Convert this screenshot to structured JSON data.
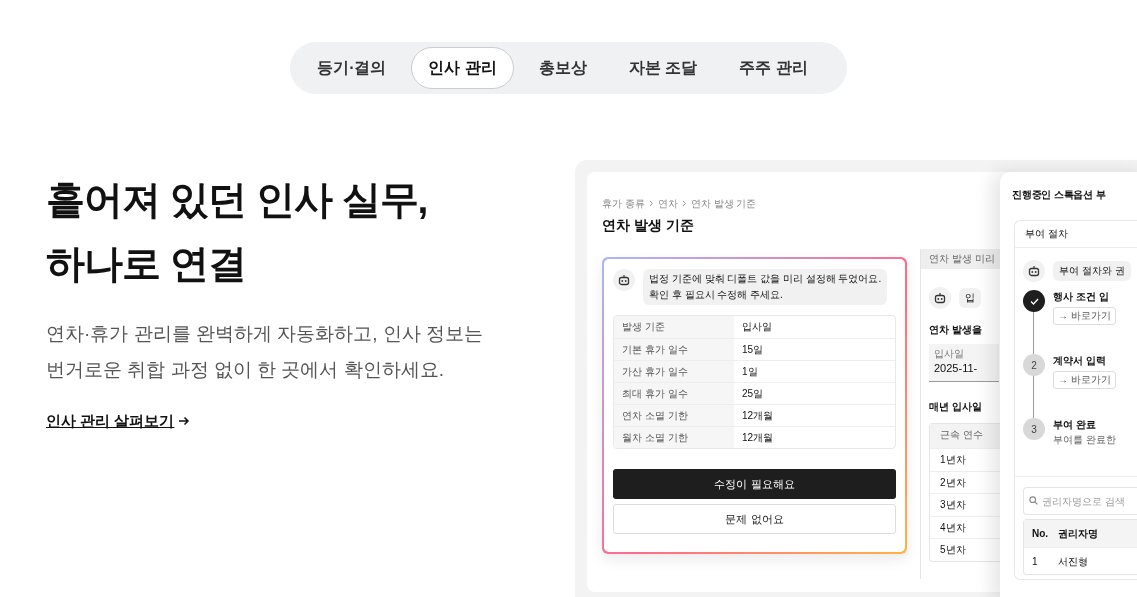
{
  "tabs": [
    {
      "label": "등기·결의",
      "selected": false
    },
    {
      "label": "인사 관리",
      "selected": true
    },
    {
      "label": "총보상",
      "selected": false
    },
    {
      "label": "자본 조달",
      "selected": false
    },
    {
      "label": "주주 관리",
      "selected": false
    }
  ],
  "hero": {
    "title_lines": [
      "흩어져 있던 인사 실무,",
      "하나로 연결"
    ],
    "description_lines": [
      "연차·휴가 관리를 완벽하게 자동화하고, 인사 정보는",
      "번거로운 취합 과정 없이 한 곳에서 확인하세요."
    ],
    "link": "인사 관리 살펴보기"
  },
  "mockup": {
    "leave_panel": {
      "breadcrumb": [
        "휴가 종류",
        "연차",
        "연차 발생 기준"
      ],
      "title": "연차 발생 기준",
      "assistant_message_lines": [
        "법정 기준에 맞춰 디폴트 값을 미리 설정해 두었어요.",
        "확인 후 필요시 수정해 주세요."
      ],
      "table": {
        "rows": [
          {
            "label": "발생 기준",
            "value": "입사일"
          },
          {
            "label": "기본 휴가 일수",
            "value": "15일"
          },
          {
            "label": "가산 휴가 일수",
            "value": "1일"
          },
          {
            "label": "최대 휴가 일수",
            "value": "25일"
          },
          {
            "label": "연차 소멸 기한",
            "value": "12개월"
          },
          {
            "label": "월차 소멸 기한",
            "value": "12개월"
          }
        ]
      },
      "buttons": [
        {
          "label": "수정이 필요해요",
          "kind": "primary"
        },
        {
          "label": "문제 없어요",
          "kind": "secondary"
        }
      ]
    },
    "preview_panel": {
      "header": "연차 발생 미리",
      "assistant_message": "입",
      "heading": "연차 발생을",
      "date_field": {
        "label": "입사일",
        "value": "2025-11-"
      },
      "table_heading": "매년 입사일",
      "table": {
        "column": "근속 연수",
        "rows": [
          "1년차",
          "2년차",
          "3년차",
          "4년차",
          "5년차"
        ]
      }
    },
    "stock_option_panel": {
      "title": "진행중인 스톡옵션 부",
      "section": "부여 절차",
      "assistant_message": "부여 절차와 권",
      "steps": [
        {
          "title": "행사 조건 입",
          "link": "→ 바로가기",
          "done": true
        },
        {
          "number": "2",
          "title": "계약서 입력",
          "link": "→ 바로가기",
          "done": false
        },
        {
          "number": "3",
          "title": "부여 완료",
          "note": "부여를 완료한",
          "done": false
        }
      ],
      "search": {
        "placeholder": "권리자명으로 검색"
      },
      "table": {
        "columns": [
          "No.",
          "권리자명"
        ],
        "rows": [
          [
            "1",
            "서진형"
          ]
        ]
      }
    }
  }
}
